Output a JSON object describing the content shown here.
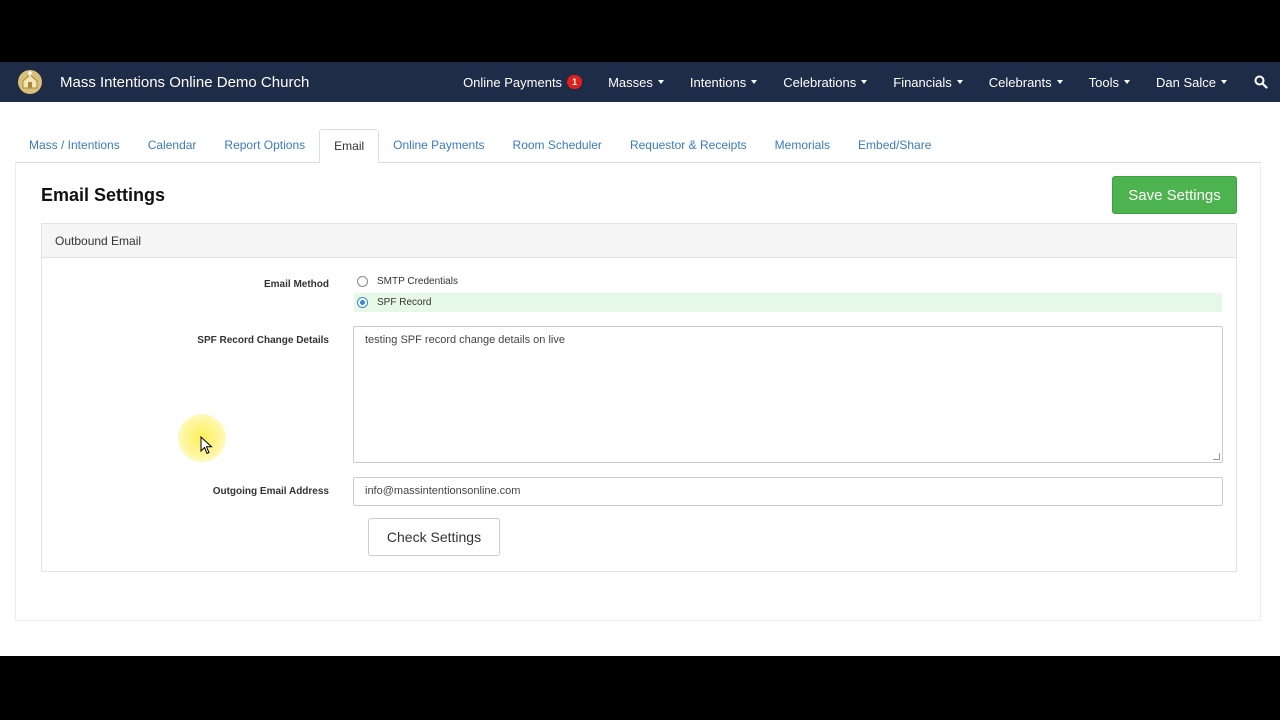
{
  "app": {
    "title": "Mass Intentions Online Demo Church"
  },
  "nav": {
    "items": [
      {
        "label": "Online Payments",
        "badge": "1",
        "caret": false
      },
      {
        "label": "Masses",
        "caret": true
      },
      {
        "label": "Intentions",
        "caret": true
      },
      {
        "label": "Celebrations",
        "caret": true
      },
      {
        "label": "Financials",
        "caret": true
      },
      {
        "label": "Celebrants",
        "caret": true
      },
      {
        "label": "Tools",
        "caret": true
      },
      {
        "label": "Dan Salce",
        "caret": true
      }
    ],
    "search_icon": "search-icon"
  },
  "tabs": [
    {
      "label": "Mass / Intentions",
      "active": false
    },
    {
      "label": "Calendar",
      "active": false
    },
    {
      "label": "Report Options",
      "active": false
    },
    {
      "label": "Email",
      "active": true
    },
    {
      "label": "Online Payments",
      "active": false
    },
    {
      "label": "Room Scheduler",
      "active": false
    },
    {
      "label": "Requestor & Receipts",
      "active": false
    },
    {
      "label": "Memorials",
      "active": false
    },
    {
      "label": "Embed/Share",
      "active": false
    }
  ],
  "page": {
    "title": "Email Settings",
    "save_label": "Save Settings"
  },
  "panel": {
    "heading": "Outbound Email",
    "email_method_label": "Email Method",
    "options": [
      {
        "label": "SMTP Credentials",
        "checked": false
      },
      {
        "label": "SPF Record",
        "checked": true
      }
    ],
    "spf_label": "SPF Record Change Details",
    "spf_value": "testing SPF record change details on live",
    "outgoing_label": "Outgoing Email Address",
    "outgoing_value": "info@massintentionsonline.com",
    "check_label": "Check Settings"
  },
  "colors": {
    "navbar": "#1e2c47",
    "link": "#3a7bbf",
    "save_button": "#4cb34f",
    "badge": "#e0201b",
    "selected_row": "#e6f9e6"
  }
}
